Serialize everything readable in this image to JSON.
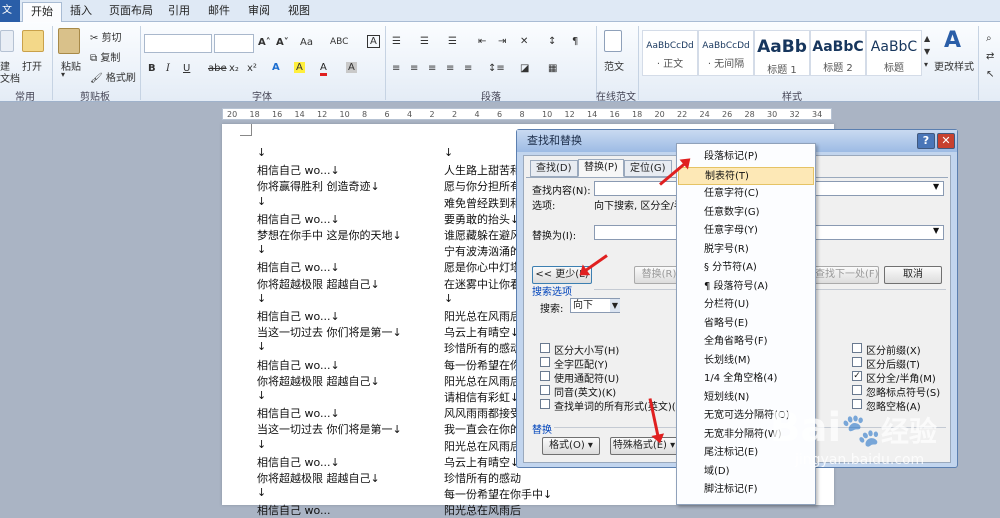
{
  "tabs": {
    "file": "文件",
    "items": [
      "开始",
      "插入",
      "页面布局",
      "引用",
      "邮件",
      "审阅",
      "视图"
    ]
  },
  "ribbon": {
    "groups": [
      "常用",
      "剪贴板",
      "字体",
      "段落",
      "在线范文",
      "样式"
    ],
    "common": {
      "open": "打开",
      "other": "建\n文档"
    },
    "clipboard": {
      "paste": "粘贴",
      "cut": "剪切",
      "copy": "复制",
      "format_painter": "格式刷"
    },
    "font_row1": [
      "A˄",
      "A˅",
      "Aa",
      "ABC",
      "A"
    ],
    "font_row2": [
      "B",
      "I",
      "U",
      "abe",
      "x₂",
      "x²",
      "A",
      "A",
      "A",
      "A"
    ],
    "online_template": "范文",
    "styles": [
      {
        "sample": "AaBbCcDd",
        "name": "· 正文"
      },
      {
        "sample": "AaBbCcDd",
        "name": "· 无间隔"
      },
      {
        "sample": "AaBb",
        "name": "标题 1"
      },
      {
        "sample": "AaBbC",
        "name": "标题 2"
      },
      {
        "sample": "AaBbC",
        "name": "标题"
      }
    ],
    "change_styles": "更改样式"
  },
  "ruler": [
    "20",
    "18",
    "16",
    "14",
    "12",
    "10",
    "8",
    "6",
    "4",
    "2",
    "2",
    "4",
    "6",
    "8",
    "10",
    "12",
    "14",
    "16",
    "18",
    "20",
    "22",
    "24",
    "26",
    "28",
    "30",
    "32",
    "34"
  ],
  "document": {
    "left_lines": [
      "↓",
      "相信自己  wo...↓",
      "你将赢得胜利  创造奇迹↓",
      "↓",
      "相信自己  wo...↓",
      "梦想在你手中  这是你的天地↓",
      "↓",
      "相信自己  wo...↓",
      "你将超越极限  超越自己↓",
      "↓",
      "相信自己  wo...↓",
      "当这一切过去  你们将是第一↓",
      "↓",
      "相信自己  wo...↓",
      "你将超越极限  超越自己↓",
      "↓",
      "相信自己  wo...↓",
      "当这一切过去  你们将是第一↓",
      "↓",
      "相信自己  wo...↓",
      "你将超越极限  超越自己↓",
      "↓",
      "相信自己  wo..."
    ],
    "right_lines": [
      "↓",
      "人生路上甜苦和",
      "愿与你分担所有",
      "难免曾经跌到和",
      "要勇敢的抬头↓",
      "谁愿藏躲在避风",
      "宁有波涛汹涌的",
      "愿是你心中灯塔",
      "在迷雾中让你看",
      "↓",
      "阳光总在风雨后",
      "乌云上有晴空↓",
      "珍惜所有的感动",
      "每一份希望在你",
      "阳光总在风雨后",
      "请相信有彩虹↓",
      "风风雨雨都接受",
      "我一直会在你的",
      "阳光总在风雨后",
      "乌云上有晴空↓",
      "珍惜所有的感动",
      "每一份希望在你手中↓",
      "阳光总在风雨后"
    ]
  },
  "dialog": {
    "title": "查找和替换",
    "help": "?",
    "close": "✕",
    "tabs": [
      "查找(D)",
      "替换(P)",
      "定位(G)"
    ],
    "find_label": "查找内容(N):",
    "options_label": "选项:",
    "options_value": "向下搜索, 区分全/半",
    "replace_label": "替换为(I):",
    "less_button": "<< 更少(L)",
    "replace_button": "替换(R)",
    "find_next_button": "查找下一处(F)",
    "cancel_button": "取消",
    "search_options_title": "搜索选项",
    "search_label": "搜索:",
    "search_value": "向下",
    "left_checks": [
      {
        "label": "区分大小写(H)",
        "checked": false
      },
      {
        "label": "全字匹配(Y)",
        "checked": false
      },
      {
        "label": "使用通配符(U)",
        "checked": false
      },
      {
        "label": "同音(英文)(K)",
        "checked": false
      },
      {
        "label": "查找单词的所有形式(英文)(W)",
        "checked": false
      }
    ],
    "right_checks": [
      {
        "label": "区分前缀(X)",
        "checked": false
      },
      {
        "label": "区分后缀(T)",
        "checked": false
      },
      {
        "label": "区分全/半角(M)",
        "checked": true
      },
      {
        "label": "忽略标点符号(S)",
        "checked": false
      },
      {
        "label": "忽略空格(A)",
        "checked": false
      }
    ],
    "replace_section": "替换",
    "format_button": "格式(O) ▾",
    "special_button": "特殊格式(E) ▾"
  },
  "special_menu": {
    "items": [
      "段落标记(P)",
      "制表符(T)",
      "任意字符(C)",
      "任意数字(G)",
      "任意字母(Y)",
      "脱字号(R)",
      "§ 分节符(A)",
      "¶ 段落符号(A)",
      "分栏符(U)",
      "省略号(E)",
      "全角省略号(F)",
      "长划线(M)",
      "1/4 全角空格(4)",
      "短划线(N)",
      "无宽可选分隔符(O)",
      "无宽非分隔符(W)",
      "尾注标记(E)",
      "域(D)",
      "脚注标记(F)"
    ],
    "highlighted_index": 1
  },
  "watermark": {
    "brand": "Bai",
    "brand2": "经验",
    "url": "jingyan.baidu.com"
  },
  "colors": {
    "accent": "#2a5ea8",
    "arrow": "#e02020",
    "highlight": "#fde8b6"
  }
}
